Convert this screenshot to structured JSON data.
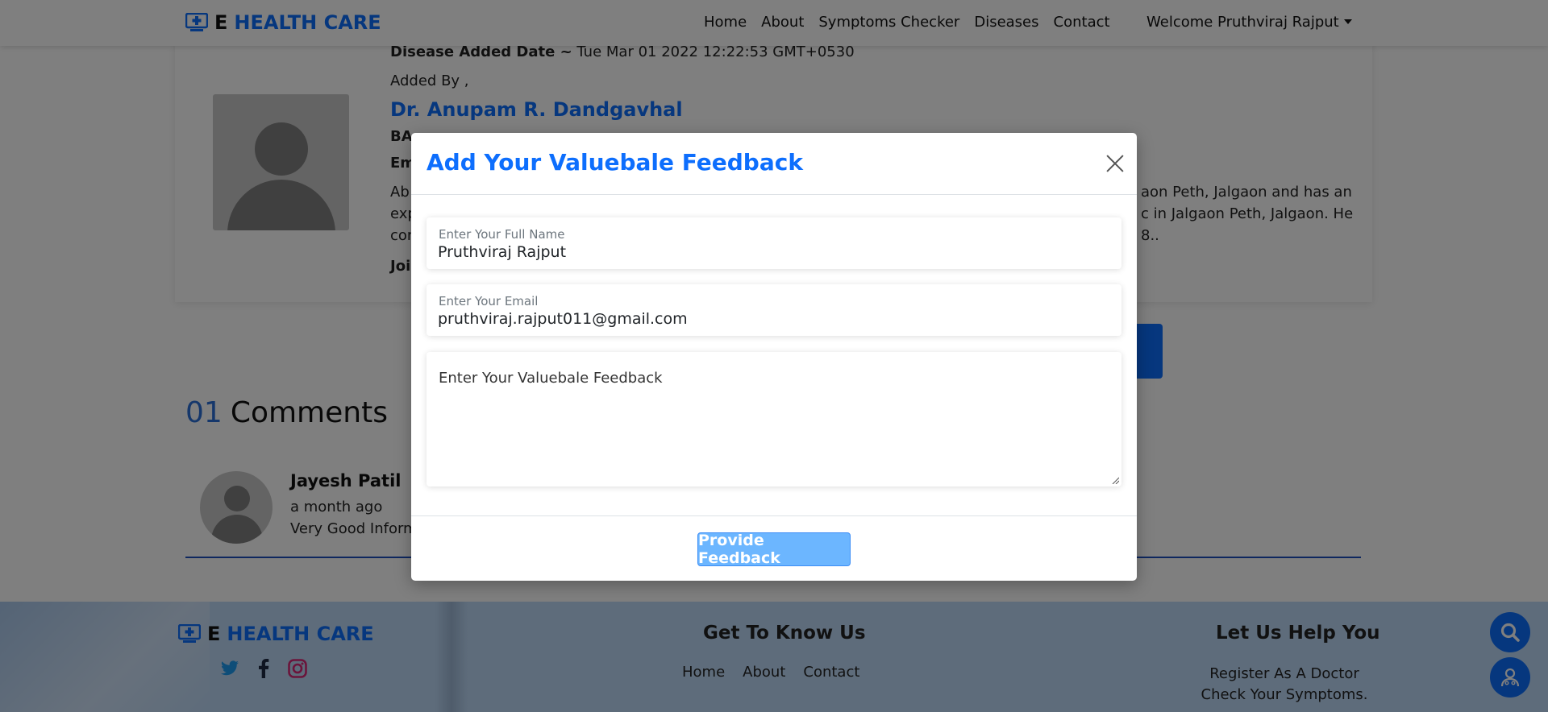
{
  "navbar": {
    "brand_e": "E",
    "brand_rest": "HEALTH CARE",
    "links": [
      "Home",
      "About",
      "Symptoms Checker",
      "Diseases",
      "Contact"
    ],
    "user_menu": "Welcome Pruthviraj Rajput"
  },
  "disease": {
    "added_date_label": "Disease Added Date ~",
    "added_date_value": "Tue Mar 01 2022 12:22:53 GMT+0530",
    "added_by": "Added By ,",
    "doctor_name": "Dr. Anupam R. Dandgavhal",
    "degree_partial": "BA",
    "email_partial": "Em",
    "about_partial_line1": "Ab",
    "about_partial_line2": "exp",
    "about_partial_line3": "con",
    "about_right_line1": "aon Peth, Jalgaon and has an",
    "about_right_line2": "c in Jalgaon Peth, Jalgaon. He",
    "about_right_line3": "8..",
    "joined_partial": "Joi"
  },
  "comments": {
    "count": "01",
    "title": "Comments",
    "items": [
      {
        "name": "Jayesh Patil",
        "time": "a month ago",
        "text": "Very Good Inform"
      }
    ]
  },
  "footer": {
    "brand_e": "E",
    "brand_rest": "HEALTH CARE",
    "know_us_title": "Get To Know Us",
    "know_us_links": [
      "Home",
      "About",
      "Contact"
    ],
    "help_title": "Let Us Help You",
    "help_links": [
      "Register As A Doctor",
      "Check Your Symptoms."
    ]
  },
  "modal": {
    "title": "Add Your Valuebale Feedback",
    "name_label": "Enter Your Full Name",
    "name_value": "Pruthviraj Rajput",
    "email_label": "Enter Your Email",
    "email_value": "pruthviraj.rajput011@gmail.com",
    "feedback_placeholder": "Enter Your Valuebale Feedback",
    "submit_label": "Provide Feedback"
  },
  "colors": {
    "primary": "#0d6efd",
    "button_light": "#6cb6ff",
    "overlay": "rgba(0,0,0,0.5)"
  }
}
